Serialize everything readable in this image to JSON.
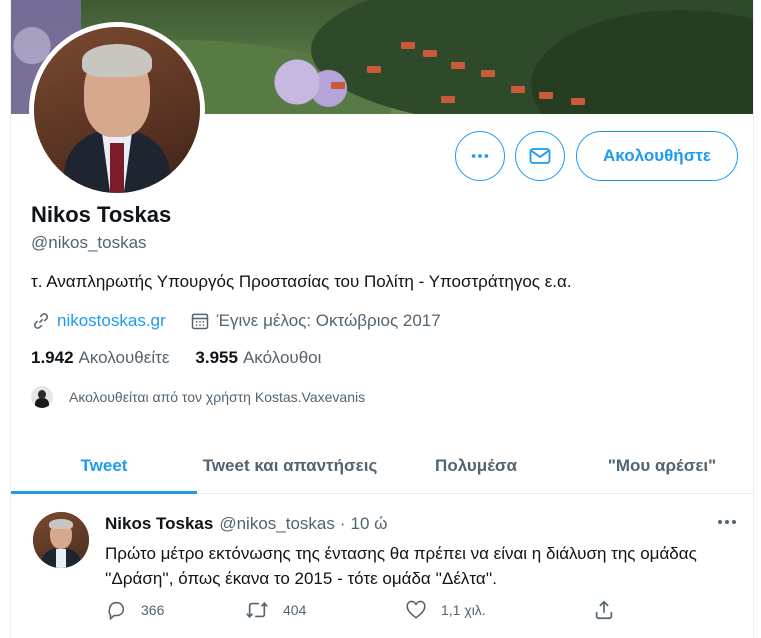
{
  "profile": {
    "name": "Nikos Toskas",
    "handle": "@nikos_toskas",
    "bio": "τ. Αναπληρωτής Υπουργός Προστασίας του Πολίτη - Υποστράτηγος ε.α.",
    "website": "nikostoskas.gr",
    "joined": "Έγινε μέλος: Οκτώβριος 2017",
    "following_count": "1.942",
    "following_label": "Ακολουθείτε",
    "followers_count": "3.955",
    "followers_label": "Ακόλουθοι",
    "followed_by": "Ακολουθείται από τον χρήστη Kostas.Vaxevanis"
  },
  "actions": {
    "more_icon": "more-icon",
    "message_icon": "mail-icon",
    "follow_label": "Ακολουθήστε"
  },
  "tabs": [
    {
      "label": "Tweet",
      "active": true
    },
    {
      "label": "Tweet και απαντήσεις",
      "active": false
    },
    {
      "label": "Πολυμέσα",
      "active": false
    },
    {
      "label": "\"Μου αρέσει\"",
      "active": false
    }
  ],
  "tweet": {
    "author": "Nikos Toskas",
    "handle": "@nikos_toskas",
    "separator": "·",
    "time": "10 ώ",
    "text": "Πρώτο μέτρο εκτόνωσης της έντασης θα πρέπει να είναι η διάλυση της ομάδας ''Δράση'', όπως έκανα το 2015 - τότε ομάδα ''Δέλτα''.",
    "replies": "366",
    "retweets": "404",
    "likes": "1,1 χιλ."
  },
  "colors": {
    "accent": "#1d9bf0",
    "text": "#0f1419",
    "secondary": "#536471",
    "border": "#ebeef0"
  }
}
